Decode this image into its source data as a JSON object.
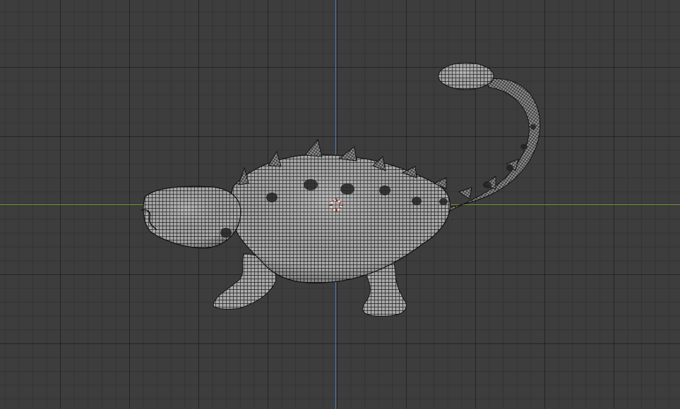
{
  "viewport": {
    "background_color": "#3d3d3d",
    "grid_color": "#2e2e2e"
  },
  "axes": {
    "x_axis_color": "#7da33a",
    "y_axis_color": "#4f7fbf"
  },
  "model": {
    "icon": "ankylosaurus-mesh",
    "mesh_color": "#a9a9a9",
    "wire_color": "#1c1c1c"
  },
  "cursor": {
    "icon": "3d-cursor-icon",
    "ring_colors": [
      "#d63a2a",
      "#f2f2f2"
    ]
  }
}
